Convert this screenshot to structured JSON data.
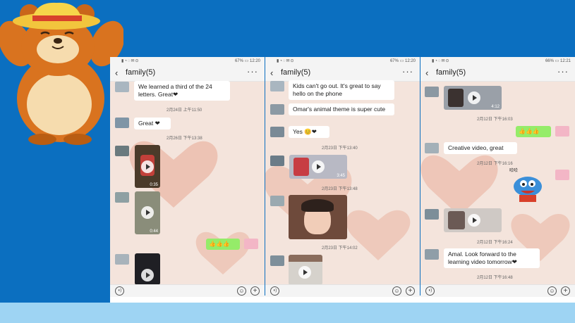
{
  "colors": {
    "background": "#0b6fc0",
    "band": "#9ed4f3",
    "chat_bg": "#f4e4dc",
    "bubble_green": "#95ec69"
  },
  "phones": [
    {
      "status_time": "12:20",
      "status_battery": "67%",
      "title": "family(5)",
      "messages": {
        "m1": "We learned a third of the 24 letters. Great❤",
        "t1": "2月24日 上午11:50",
        "m2": "Great ❤",
        "t2": "2月26日 下午13:38",
        "v1_dur": "0:35",
        "v2_dur": "0:44",
        "m3": "👍👍👍"
      }
    },
    {
      "status_time": "12:20",
      "status_battery": "67%",
      "title": "family(5)",
      "messages": {
        "m1": "Kids can't go out. It's great to say hello on the phone",
        "m2": "Omar's animal theme is super cute",
        "m3": "Yes 😊❤",
        "t1": "2月23日 下午13:40",
        "v1_dur": "3:45",
        "t2": "2月23日 下午13:48",
        "t3": "2月23日 下午14:02"
      }
    },
    {
      "status_time": "12:21",
      "status_battery": "66%",
      "title": "family(5)",
      "messages": {
        "v1_dur": "4:12",
        "t1": "2月12日 下午16:03",
        "m1": "👍👍👍",
        "m2": "Creative video, great",
        "t2": "2月12日 下午16:16",
        "sticker": "哈哈",
        "t3": "2月12日 下午16:24",
        "m3": "Amal. Look forward to the learning video tomorrow❤",
        "t4": "2月12日 下午16:48"
      }
    }
  ],
  "icons": {
    "back": "chevron-left-icon",
    "more": "more-dots-icon",
    "voice": "voice-icon",
    "emoji": "emoji-icon",
    "plus": "plus-icon",
    "play": "play-icon"
  }
}
